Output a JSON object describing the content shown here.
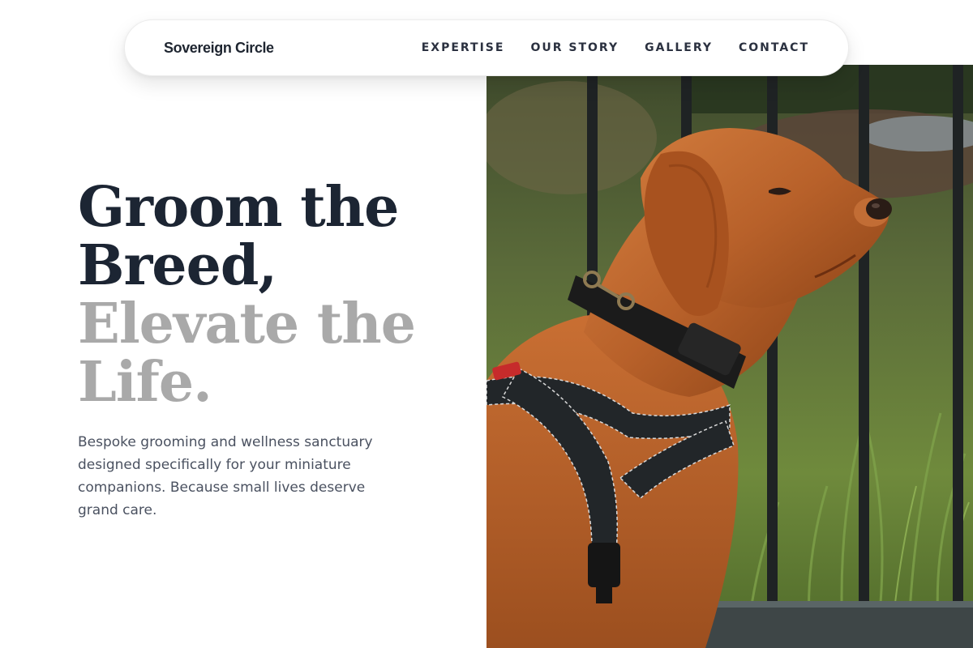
{
  "nav": {
    "brand": "Sovereign Circle",
    "links": [
      "EXPERTISE",
      "OUR STORY",
      "GALLERY",
      "CONTACT"
    ]
  },
  "hero": {
    "headline_dark": [
      "Groom the",
      "Breed,"
    ],
    "headline_light": [
      "Elevate the",
      "Life."
    ],
    "tagline": "Bespoke grooming and wellness sanctuary designed specifically for your miniature companions. Because small lives deserve grand care."
  },
  "colors": {
    "heading": "#1c2533",
    "heading_muted": "#a9a9a9",
    "body_text": "#4a5160"
  }
}
